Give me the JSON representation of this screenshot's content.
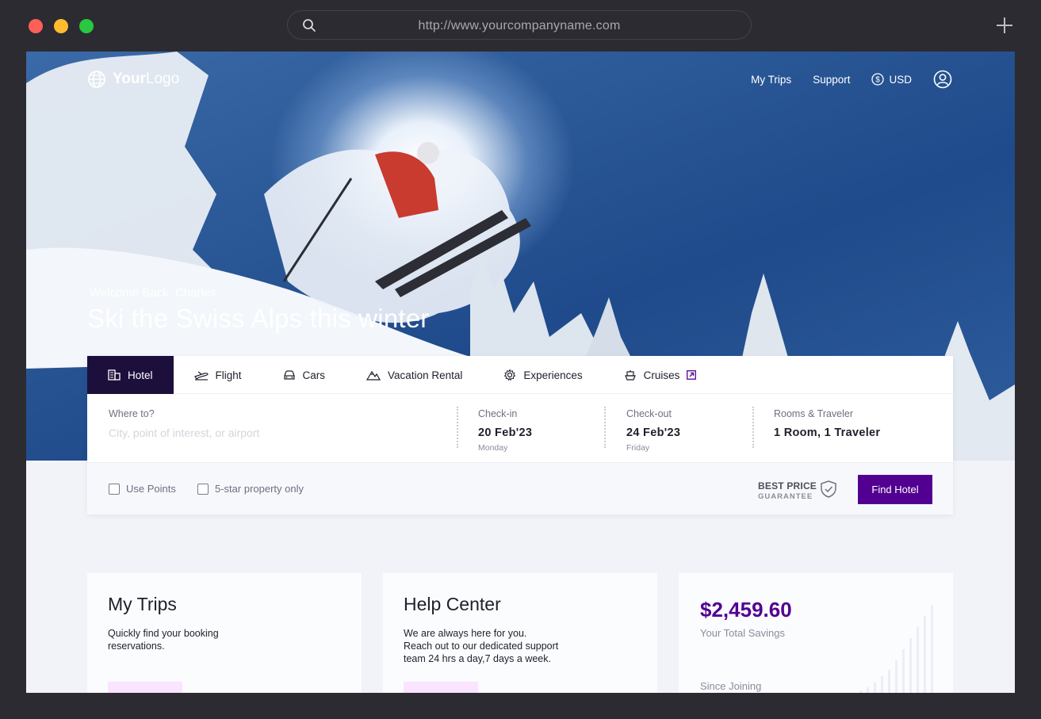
{
  "browser": {
    "url": "http://www.yourcompanyname.com"
  },
  "nav": {
    "logo_prefix": "Your",
    "logo_suffix": "Logo",
    "my_trips": "My Trips",
    "support": "Support",
    "currency": "USD"
  },
  "hero": {
    "welcome": "Welcome Back, Charles",
    "headline": "Ski the Swiss Alps this winter"
  },
  "tabs": [
    {
      "label": "Hotel",
      "icon": "hotel-icon",
      "active": true
    },
    {
      "label": "Flight",
      "icon": "plane-icon"
    },
    {
      "label": "Cars",
      "icon": "car-icon"
    },
    {
      "label": "Vacation Rental",
      "icon": "mountain-icon"
    },
    {
      "label": "Experiences",
      "icon": "gear-icon"
    },
    {
      "label": "Cruises",
      "icon": "ship-icon"
    }
  ],
  "search": {
    "where_label": "Where to?",
    "where_placeholder": "City, point of interest, or airport",
    "checkin_label": "Check-in",
    "checkin_value": "20 Feb'23",
    "checkin_day": "Monday",
    "checkout_label": "Check-out",
    "checkout_value": "24 Feb'23",
    "checkout_day": "Friday",
    "rooms_label": "Rooms & Traveler",
    "rooms_value": "1 Room, 1 Traveler"
  },
  "options": {
    "use_points": "Use Points",
    "five_star": "5-star property only",
    "best_price_line1": "BEST PRICE",
    "best_price_line2": "GUARANTEE",
    "find_button": "Find Hotel"
  },
  "cards": {
    "trips_title": "My Trips",
    "trips_text_1": "Quickly find your booking",
    "trips_text_2": "reservations.",
    "help_title": "Help Center",
    "help_text_1": "We are always here for you.",
    "help_text_2": "Reach out to our dedicated support",
    "help_text_3": "team 24 hrs a day,7 days a week.",
    "savings_value": "$2,459.60",
    "savings_label": "Your Total Savings",
    "since_label": "Since Joining"
  },
  "colors": {
    "accent": "#520091",
    "active_tab": "#1c0f3c",
    "pill": "#fbe4ff"
  }
}
